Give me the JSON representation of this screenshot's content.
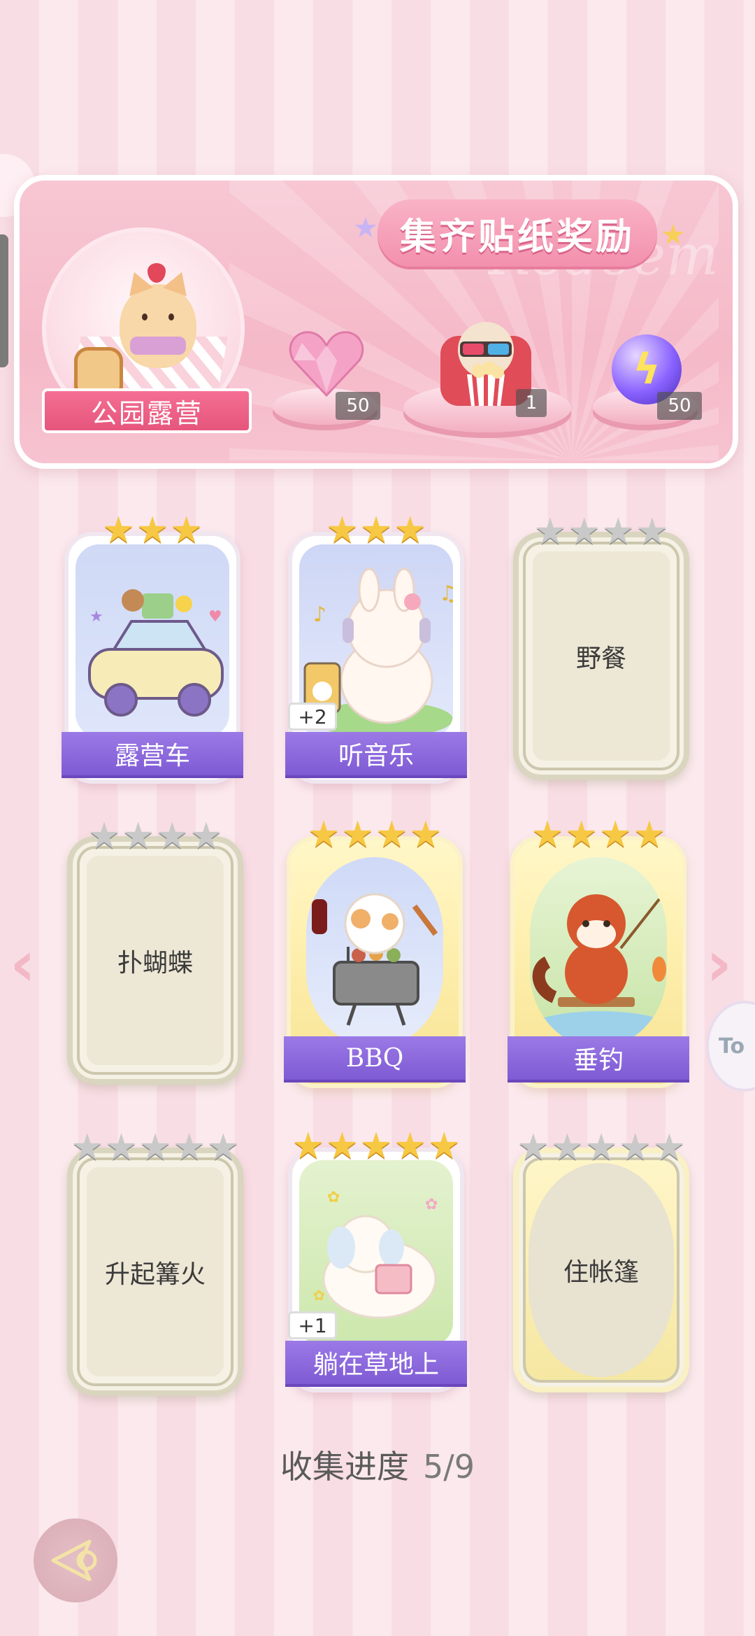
{
  "banner": {
    "title": "集齐贴纸奖励",
    "watermark": "Redeem",
    "album_name": "公园露营",
    "rewards": [
      {
        "name": "heart-gem",
        "count": "50"
      },
      {
        "name": "cinema-cat",
        "count": "1"
      },
      {
        "name": "energy-orb",
        "count": "50"
      }
    ]
  },
  "stickers": [
    {
      "label": "露营车",
      "state": "unlocked",
      "stars": 3,
      "star_total": 3
    },
    {
      "label": "听音乐",
      "state": "unlocked",
      "stars": 3,
      "star_total": 3,
      "badge": "+2"
    },
    {
      "label": "野餐",
      "state": "locked",
      "stars": 0,
      "star_total": 4
    },
    {
      "label": "扑蝴蝶",
      "state": "locked",
      "stars": 0,
      "star_total": 4
    },
    {
      "label": "BBQ",
      "state": "unlocked",
      "stars": 4,
      "star_total": 4
    },
    {
      "label": "垂钓",
      "state": "unlocked",
      "stars": 4,
      "star_total": 4
    },
    {
      "label": "升起篝火",
      "state": "locked",
      "stars": 0,
      "star_total": 5
    },
    {
      "label": "躺在草地上",
      "state": "unlocked",
      "stars": 5,
      "star_total": 5,
      "badge": "+1"
    },
    {
      "label": "住帐篷",
      "state": "locked",
      "stars": 0,
      "star_total": 5
    }
  ],
  "progress": {
    "label": "收集进度",
    "value": "5/9"
  },
  "side_button_text": "To",
  "colors": {
    "accent_pink": "#f390ad",
    "name_bar_purple": "#8c67dc",
    "star_gold": "#f7c843",
    "star_grey": "#c9c9c9"
  }
}
